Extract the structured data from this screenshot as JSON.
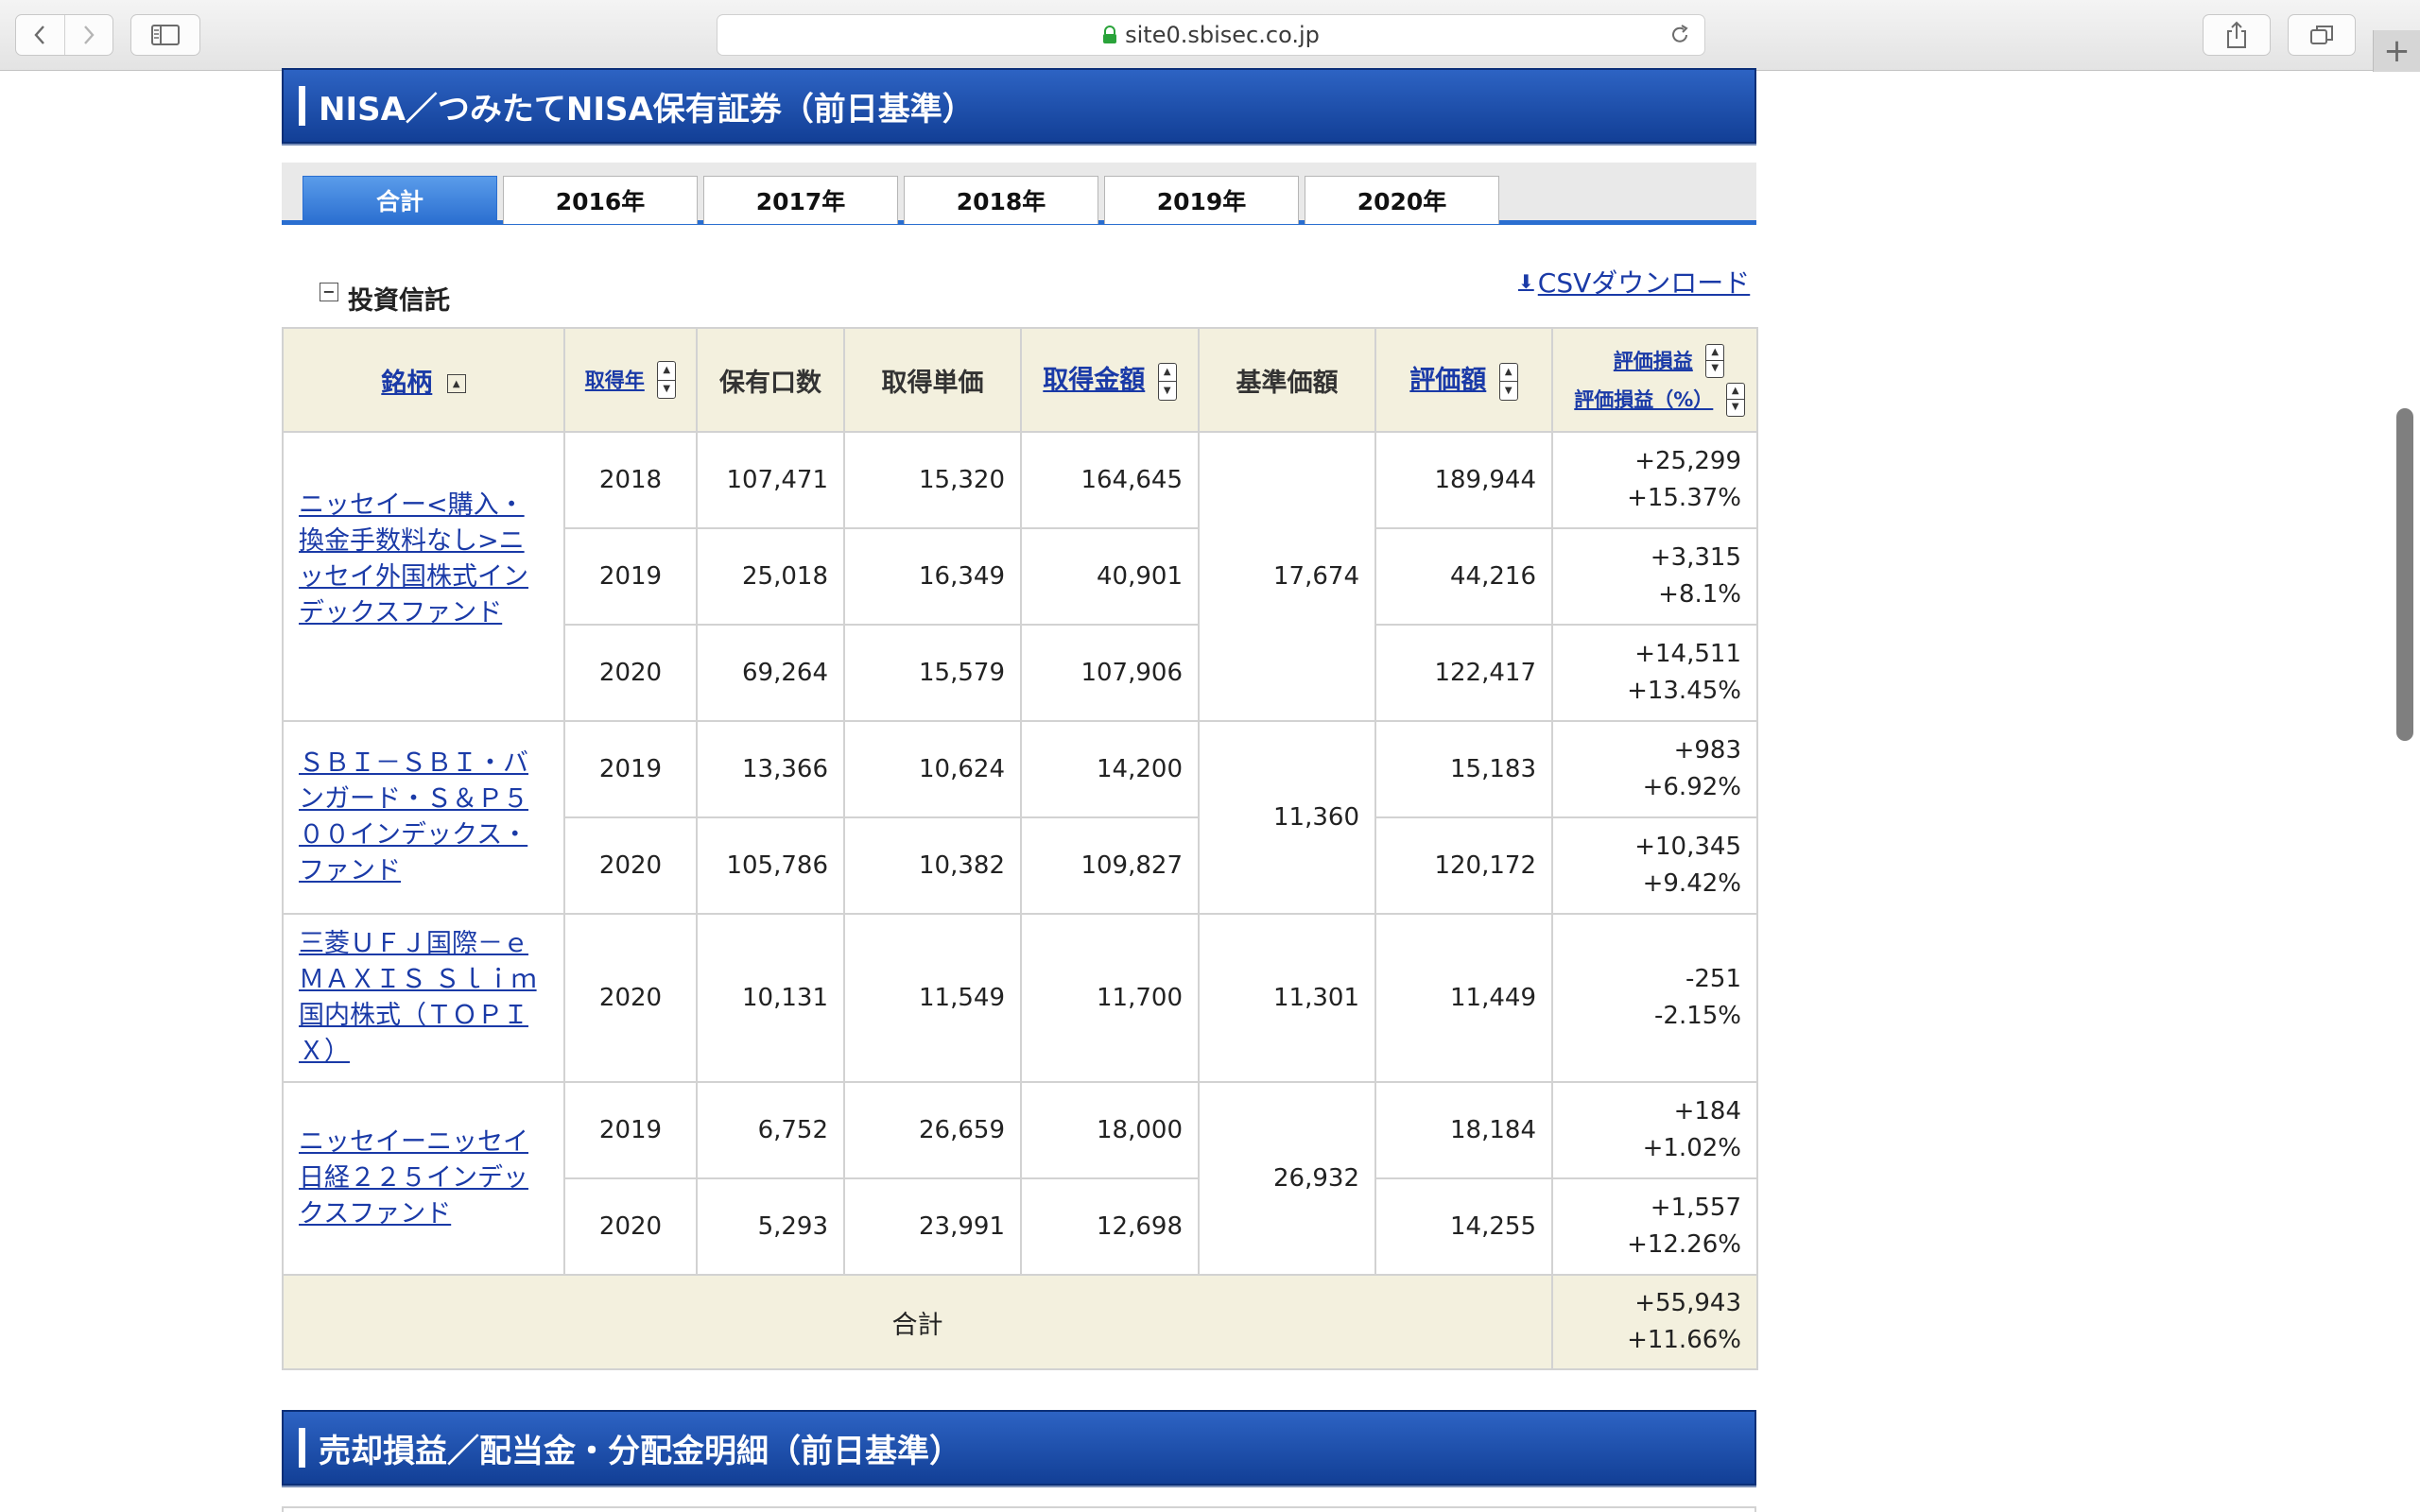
{
  "browser": {
    "url": "site0.sbisec.co.jp"
  },
  "sections": {
    "nisa_title": "NISA／つみたてNISA保有証券（前日基準）",
    "sales_title": "売却損益／配当金・分配金明細（前日基準）"
  },
  "tabs": [
    {
      "label": "合計",
      "active": true
    },
    {
      "label": "2016年",
      "active": false
    },
    {
      "label": "2017年",
      "active": false
    },
    {
      "label": "2018年",
      "active": false
    },
    {
      "label": "2019年",
      "active": false
    },
    {
      "label": "2020年",
      "active": false
    }
  ],
  "subsection": {
    "minus": "−",
    "title": "投資信託"
  },
  "csv_link": "CSVダウンロード",
  "table": {
    "headers": {
      "name": "銘柄",
      "year": "取得年",
      "units": "保有口数",
      "unit_price": "取得単価",
      "cost": "取得金額",
      "nav": "基準価額",
      "value": "評価額",
      "pl": "評価損益",
      "pl_pct": "評価損益（%）"
    },
    "funds": [
      {
        "name": "ニッセイー<購入・換金手数料なし>ニッセイ外国株式インデックスファンド",
        "nav": "17,674",
        "rows": [
          {
            "year": "2018",
            "units": "107,471",
            "unit_price": "15,320",
            "cost": "164,645",
            "value": "189,944",
            "pl": "+25,299",
            "pl_pct": "+15.37%"
          },
          {
            "year": "2019",
            "units": "25,018",
            "unit_price": "16,349",
            "cost": "40,901",
            "value": "44,216",
            "pl": "+3,315",
            "pl_pct": "+8.1%"
          },
          {
            "year": "2020",
            "units": "69,264",
            "unit_price": "15,579",
            "cost": "107,906",
            "value": "122,417",
            "pl": "+14,511",
            "pl_pct": "+13.45%"
          }
        ]
      },
      {
        "name": "ＳＢＩ－ＳＢＩ・バンガード・Ｓ＆Ｐ５００インデックス・ファンド",
        "nav": "11,360",
        "rows": [
          {
            "year": "2019",
            "units": "13,366",
            "unit_price": "10,624",
            "cost": "14,200",
            "value": "15,183",
            "pl": "+983",
            "pl_pct": "+6.92%"
          },
          {
            "year": "2020",
            "units": "105,786",
            "unit_price": "10,382",
            "cost": "109,827",
            "value": "120,172",
            "pl": "+10,345",
            "pl_pct": "+9.42%"
          }
        ]
      },
      {
        "name": "三菱ＵＦＪ国際－ｅＭＡＸＩＳ Ｓｌｉｍ国内株式（ＴＯＰＩＸ）",
        "nav": "11,301",
        "rows": [
          {
            "year": "2020",
            "units": "10,131",
            "unit_price": "11,549",
            "cost": "11,700",
            "value": "11,449",
            "pl": "-251",
            "pl_pct": "-2.15%"
          }
        ]
      },
      {
        "name": "ニッセイーニッセイ日経２２５インデックスファンド",
        "nav": "26,932",
        "rows": [
          {
            "year": "2019",
            "units": "6,752",
            "unit_price": "26,659",
            "cost": "18,000",
            "value": "18,184",
            "pl": "+184",
            "pl_pct": "+1.02%"
          },
          {
            "year": "2020",
            "units": "5,293",
            "unit_price": "23,991",
            "cost": "12,698",
            "value": "14,255",
            "pl": "+1,557",
            "pl_pct": "+12.26%"
          }
        ]
      }
    ],
    "total": {
      "label": "合計",
      "pl": "+55,943",
      "pl_pct": "+11.66%"
    }
  },
  "colors": {
    "positive": "#e0141e",
    "negative": "#1c3fc4",
    "header_blue": "#1a4ea8",
    "link": "#1a3aa7"
  }
}
